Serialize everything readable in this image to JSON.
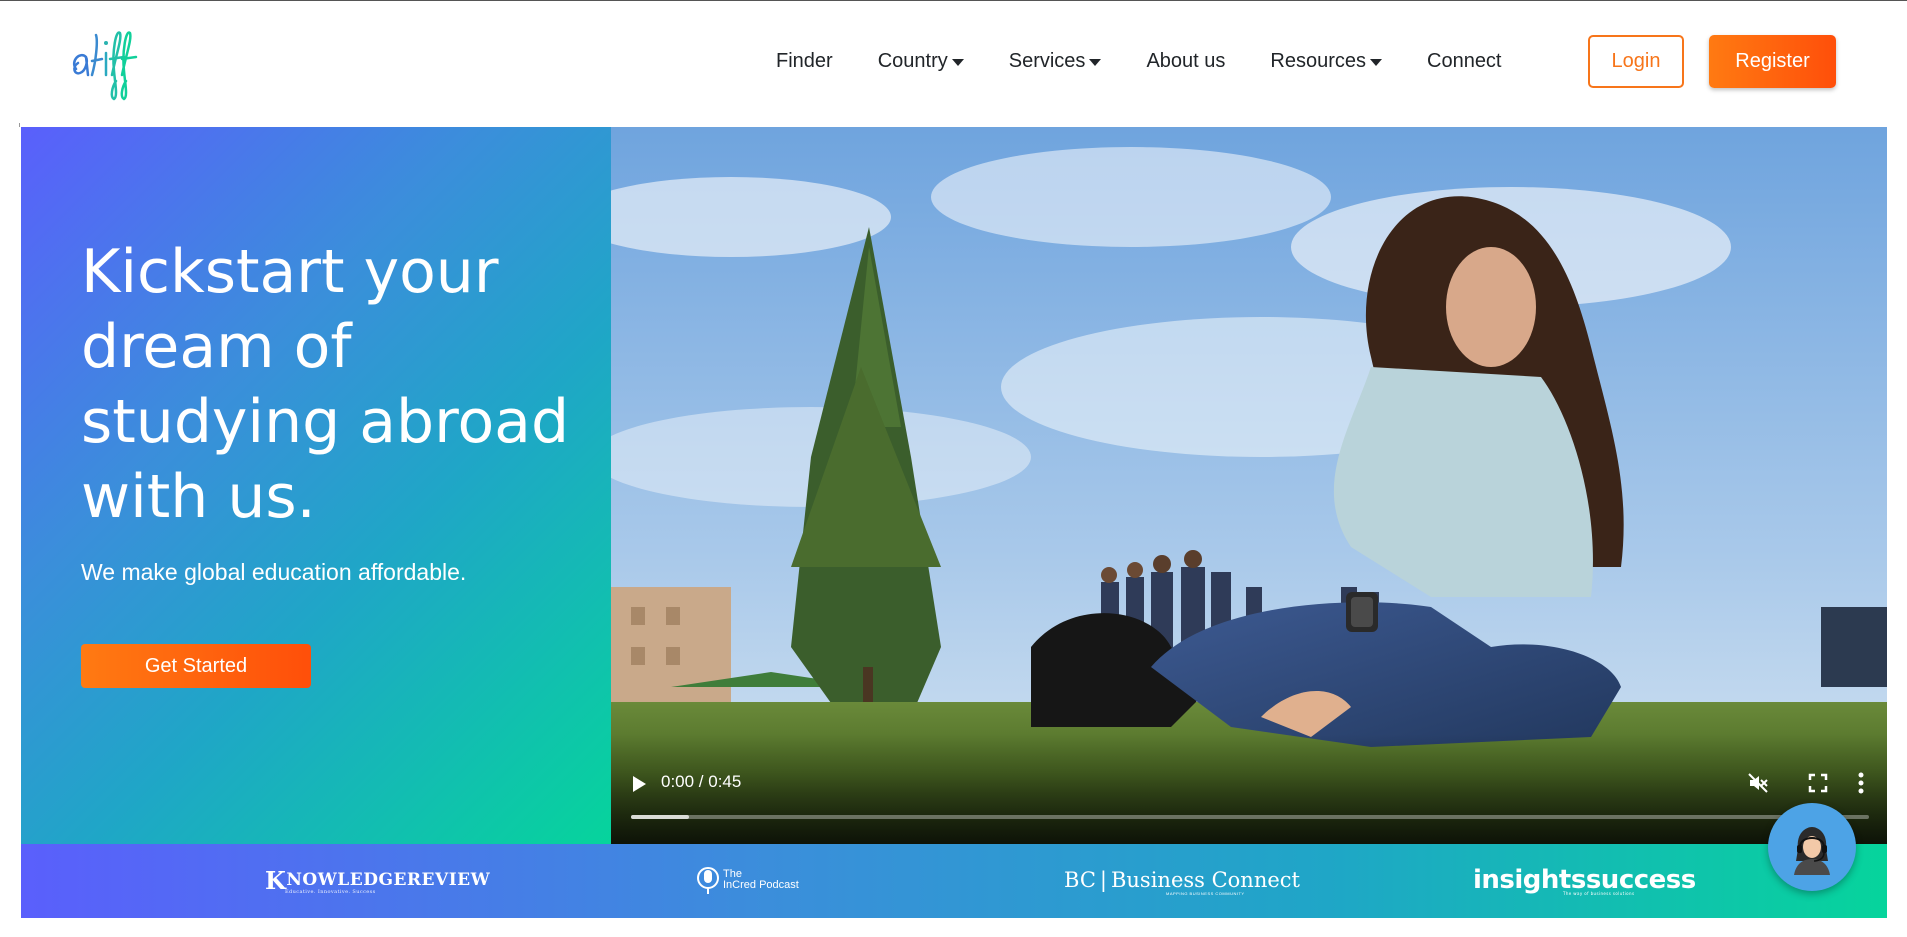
{
  "brand": {
    "logo_text": "aliff",
    "accent": "#f7751a",
    "gradient_start": "#5a5ffc",
    "gradient_end": "#06d49c"
  },
  "nav": {
    "items": [
      {
        "label": "Finder",
        "dropdown": false
      },
      {
        "label": "Country",
        "dropdown": true
      },
      {
        "label": "Services",
        "dropdown": true
      },
      {
        "label": "About us",
        "dropdown": false
      },
      {
        "label": "Resources",
        "dropdown": true
      },
      {
        "label": "Connect",
        "dropdown": false
      }
    ],
    "login_label": "Login",
    "register_label": "Register"
  },
  "hero": {
    "title": "Kickstart your dream of studying abroad with us.",
    "subtitle": "We make global education affordable.",
    "cta_label": "Get Started"
  },
  "video": {
    "time": "0:00 / 0:45",
    "progress_fraction": 0.047,
    "muted": true,
    "controls": [
      "play-icon",
      "mute-icon",
      "fullscreen-icon",
      "more-options-icon"
    ]
  },
  "press": {
    "knowledge_review": {
      "prefix": "K",
      "name": "NOWLEDGEREVIEW",
      "tagline": "Educative. Innovative. Success"
    },
    "incred": {
      "line1": "The",
      "line2": "InCred Podcast"
    },
    "business_connect": {
      "abbr": "BC",
      "name": "Business Connect",
      "tagline": "MAPPING BUSINESS COMMUNITY"
    },
    "insights_success": {
      "name": "insightssuccess",
      "tagline": "The way of business solutions"
    }
  },
  "chat": {
    "icon": "support-agent-icon"
  }
}
